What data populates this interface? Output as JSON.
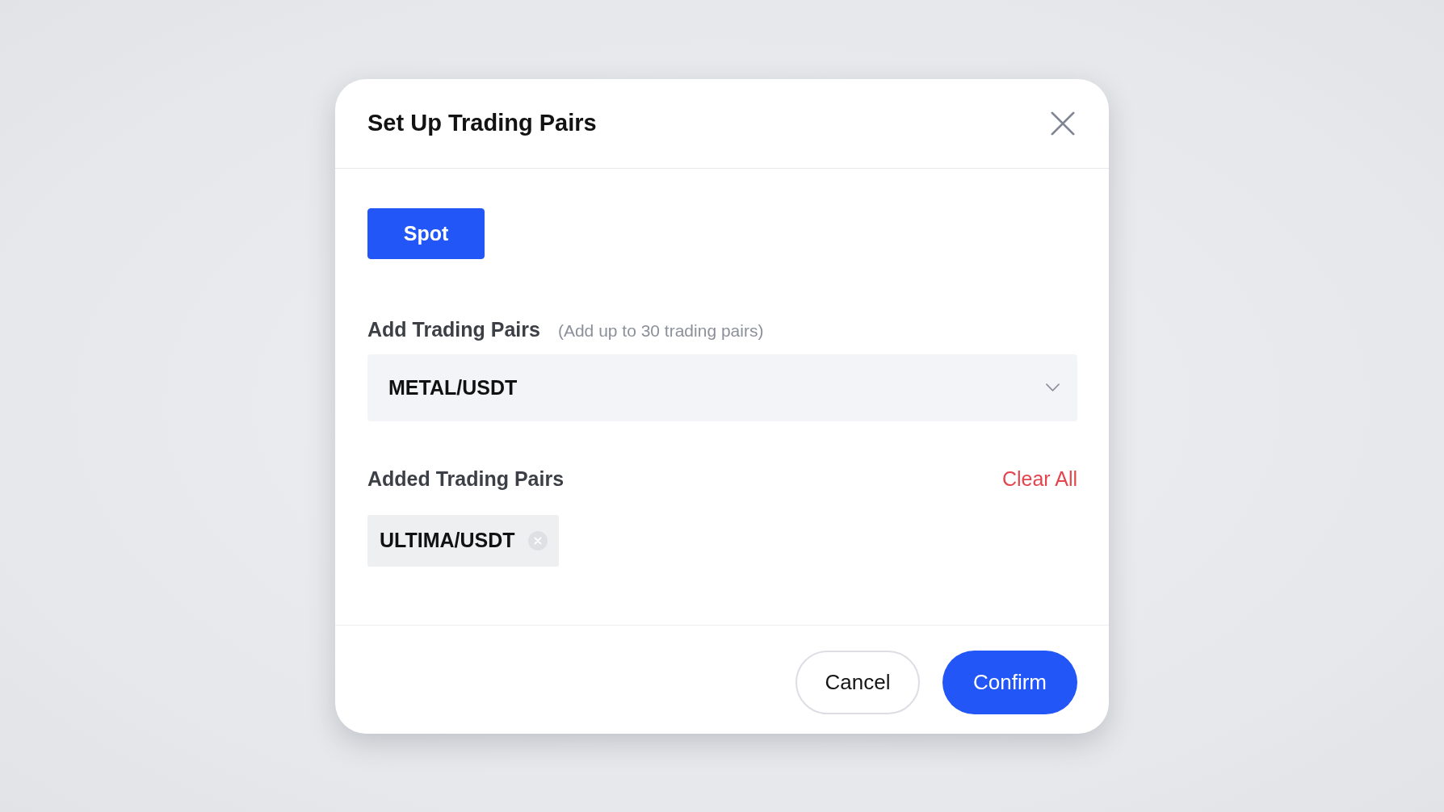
{
  "dialog": {
    "title": "Set Up Trading Pairs"
  },
  "market_tabs": [
    {
      "label": "Spot",
      "selected": true
    }
  ],
  "add_section": {
    "label": "Add Trading Pairs",
    "hint": "(Add up to 30 trading pairs)",
    "select": {
      "value": "METAL/USDT"
    }
  },
  "added_section": {
    "label": "Added Trading Pairs",
    "clear_all": "Clear All",
    "tags": [
      {
        "label": "ULTIMA/USDT"
      }
    ]
  },
  "buttons": [
    {
      "label": "Cancel",
      "kind": "secondary"
    },
    {
      "label": "Confirm",
      "kind": "primary"
    }
  ]
}
